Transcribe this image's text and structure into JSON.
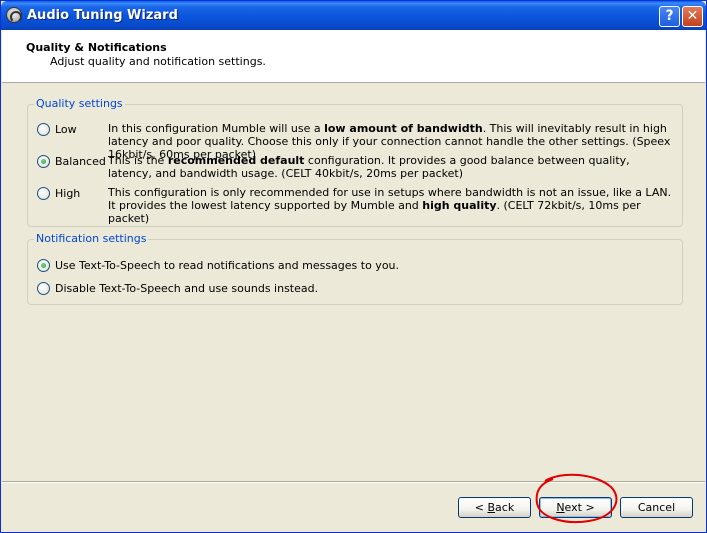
{
  "window": {
    "title": "Audio Tuning Wizard",
    "help_glyph": "?",
    "close_glyph": "✕"
  },
  "header": {
    "title": "Quality & Notifications",
    "subtitle": "Adjust quality and notification settings."
  },
  "quality": {
    "group_label": "Quality settings",
    "options": [
      {
        "label": "Low",
        "checked": false,
        "desc": [
          "In this configuration Mumble will use a ",
          "low amount of bandwidth",
          ". This will inevitably result in high latency and poor quality. Choose this only if your connection cannot handle the other settings. (Speex 16kbit/s, 60ms per packet)"
        ]
      },
      {
        "label": "Balanced",
        "checked": true,
        "desc": [
          "This is the ",
          "recommended default",
          " configuration. It provides a good balance between quality, latency, and bandwidth usage. (CELT 40kbit/s, 20ms per packet)"
        ]
      },
      {
        "label": "High",
        "checked": false,
        "desc": [
          "This configuration is only recommended for use in setups where bandwidth is not an issue, like a LAN. It provides the lowest latency supported by Mumble and ",
          "high quality",
          ". (CELT 72kbit/s, 10ms per packet)"
        ]
      }
    ]
  },
  "notification": {
    "group_label": "Notification settings",
    "options": [
      {
        "label": "Use Text-To-Speech to read notifications and messages to you.",
        "checked": true
      },
      {
        "label": "Disable Text-To-Speech and use sounds instead.",
        "checked": false
      }
    ]
  },
  "buttons": {
    "back": {
      "prefix": "< ",
      "mnemonic": "B",
      "rest": "ack"
    },
    "next": {
      "mnemonic": "N",
      "rest": "ext >"
    },
    "cancel": {
      "label": "Cancel"
    }
  },
  "colors": {
    "group_label": "#0046d5",
    "annotation": "#e00000",
    "titlebar": "#0a54dc"
  }
}
